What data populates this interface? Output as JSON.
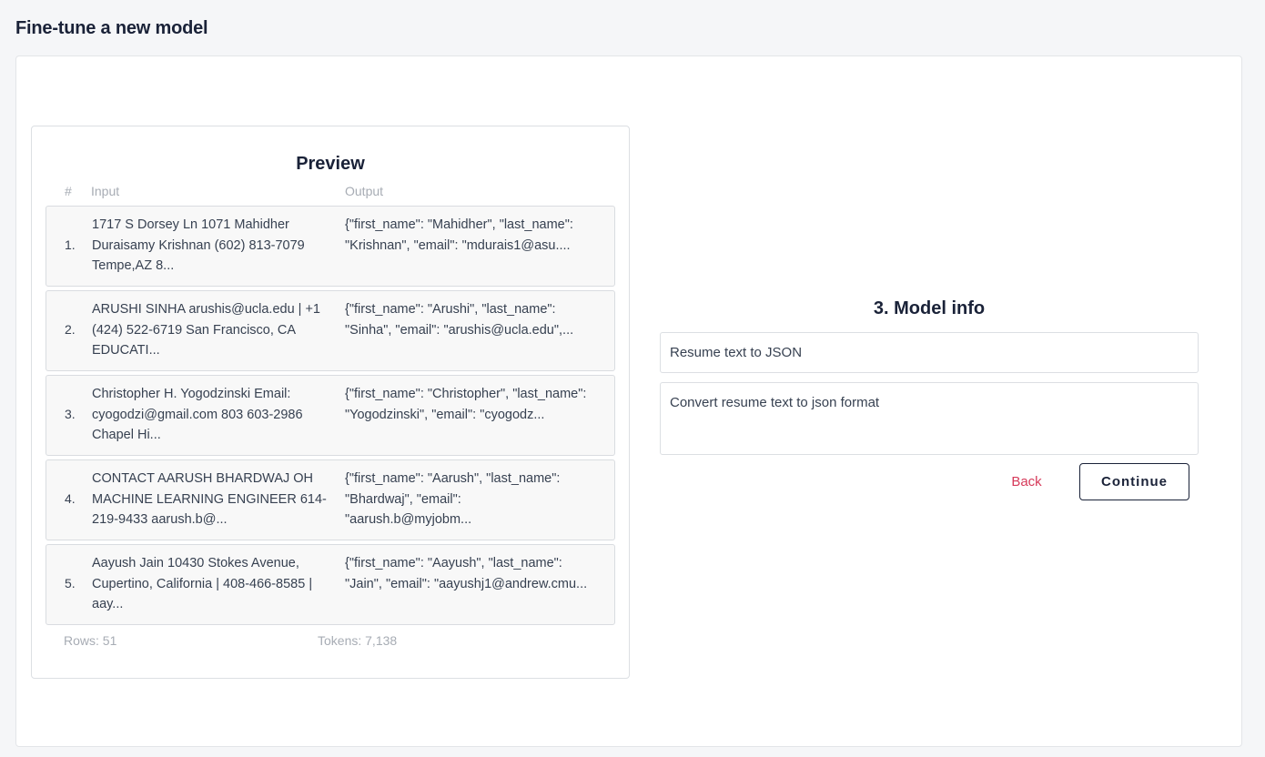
{
  "page": {
    "title": "Fine-tune a new model"
  },
  "preview": {
    "title": "Preview",
    "columns": {
      "hash": "#",
      "input": "Input",
      "output": "Output"
    },
    "rows": [
      {
        "num": "1.",
        "input": "1717 S Dorsey Ln 1071 Mahidher Duraisamy Krishnan (602) 813-7079 Tempe,AZ 8...",
        "output": "{\"first_name\": \"Mahidher\", \"last_name\": \"Krishnan\", \"email\": \"mdurais1@asu...."
      },
      {
        "num": "2.",
        "input": "ARUSHI SINHA arushis@ucla.edu | +1 (424) 522-6719 San Francisco, CA EDUCATI...",
        "output": "{\"first_name\": \"Arushi\", \"last_name\": \"Sinha\", \"email\": \"arushis@ucla.edu\",..."
      },
      {
        "num": "3.",
        "input": "Christopher H. Yogodzinski Email: cyogodzi@gmail.com 803 603-2986 Chapel Hi...",
        "output": "{\"first_name\": \"Christopher\", \"last_name\": \"Yogodzinski\", \"email\": \"cyogodz..."
      },
      {
        "num": "4.",
        "input": "CONTACT AARUSH BHARDWAJ OH MACHINE LEARNING ENGINEER 614-219-9433 aarush.b@...",
        "output": "{\"first_name\": \"Aarush\", \"last_name\": \"Bhardwaj\", \"email\": \"aarush.b@myjobm..."
      },
      {
        "num": "5.",
        "input": "Aayush Jain 10430 Stokes Avenue, Cupertino, California | 408-466-8585 | aay...",
        "output": "{\"first_name\": \"Aayush\", \"last_name\": \"Jain\", \"email\": \"aayushj1@andrew.cmu..."
      }
    ],
    "rows_stat": "Rows: 51",
    "tokens_stat": "Tokens: 7,138"
  },
  "model_info": {
    "title": "3. Model info",
    "name_value": "Resume text to JSON",
    "description_value": "Convert resume text to json format",
    "back_label": "Back",
    "continue_label": "Continue"
  },
  "colors": {
    "accent_dark": "#1a2238",
    "back_link": "#d63a5a",
    "muted": "#a7acb4"
  }
}
